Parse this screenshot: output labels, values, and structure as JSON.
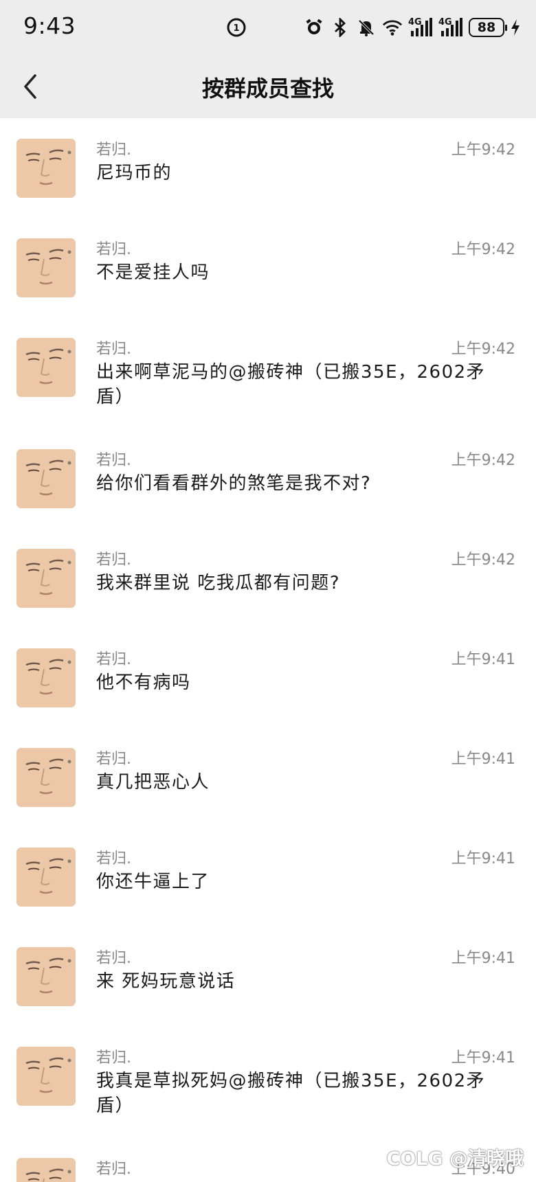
{
  "status_bar": {
    "time": "9:43",
    "net_label_1": "4G",
    "net_label_2": "4G",
    "battery": "88"
  },
  "nav": {
    "title": "按群成员查找"
  },
  "messages": [
    {
      "sender": "若归.",
      "time": "上午9:42",
      "text": "尼玛币的"
    },
    {
      "sender": "若归.",
      "time": "上午9:42",
      "text": "不是爱挂人吗"
    },
    {
      "sender": "若归.",
      "time": "上午9:42",
      "text": "出来啊草泥马的@搬砖神（已搬35E，2602矛盾）"
    },
    {
      "sender": "若归.",
      "time": "上午9:42",
      "text": "给你们看看群外的煞笔是我不对?"
    },
    {
      "sender": "若归.",
      "time": "上午9:42",
      "text": "我来群里说 吃我瓜都有问题?"
    },
    {
      "sender": "若归.",
      "time": "上午9:41",
      "text": "他不有病吗"
    },
    {
      "sender": "若归.",
      "time": "上午9:41",
      "text": "真几把恶心人"
    },
    {
      "sender": "若归.",
      "time": "上午9:41",
      "text": "你还牛逼上了"
    },
    {
      "sender": "若归.",
      "time": "上午9:41",
      "text": "来 死妈玩意说话"
    },
    {
      "sender": "若归.",
      "time": "上午9:41",
      "text": "我真是草拟死妈@搬砖神（已搬35E，2602矛盾）"
    },
    {
      "sender": "若归.",
      "time": "上午9:40",
      "text": ""
    }
  ],
  "watermark": "COLG @清晓哦"
}
